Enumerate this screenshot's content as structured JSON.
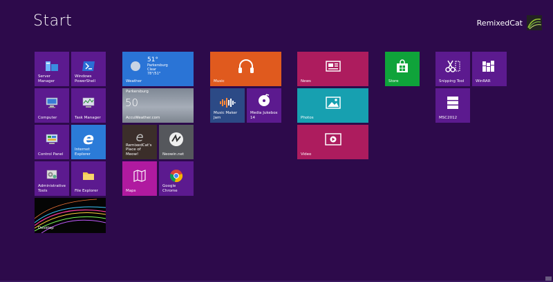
{
  "header": {
    "title": "Start",
    "username": "RemixedCat"
  },
  "tiles": {
    "server_manager": "Server Manager",
    "powershell": "Windows PowerShell",
    "computer": "Computer",
    "task_manager": "Task Manager",
    "control_panel": "Control Panel",
    "internet_explorer": "Internet Explorer",
    "admin_tools": "Administrative Tools",
    "file_explorer": "File Explorer",
    "desktop": "Desktop",
    "weather": {
      "label": "Weather",
      "temp": "51°",
      "city": "Parkersburg",
      "condition": "Clear",
      "range": "78°/51°"
    },
    "accuweather": {
      "label": "AccuWeather.com",
      "city": "Parkersburg",
      "temp": "50"
    },
    "remixedcat_place": "RemixedCat's Place of Meow!",
    "neowin": "Neowin.net",
    "maps": "Maps",
    "chrome": "Google Chrome",
    "music": "Music",
    "music_maker": "Music Maker Jam",
    "media_jukebox": "Media Jukebox 14",
    "news": "News",
    "photos": "Photos",
    "video": "Video",
    "store": "Store",
    "snipping_tool": "Snipping Tool",
    "winrar": "WinRAR",
    "msc2012": "MSC2012"
  }
}
